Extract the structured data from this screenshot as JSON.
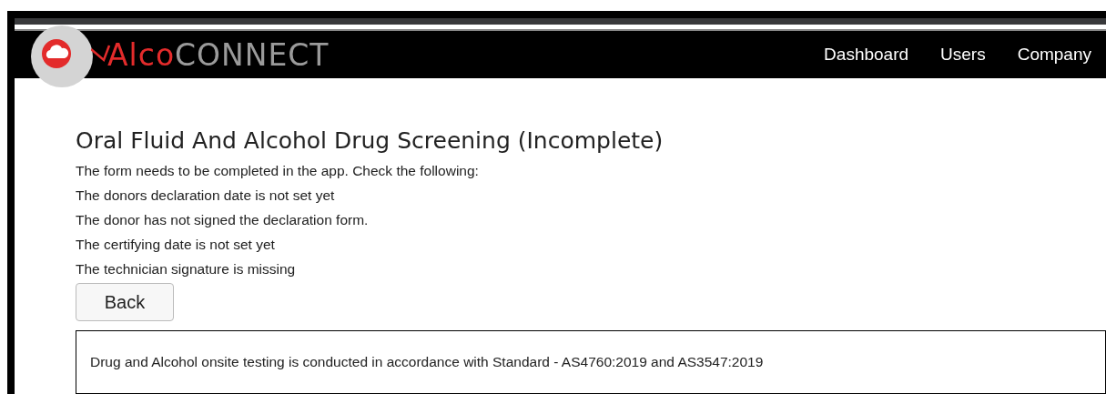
{
  "brand": {
    "part_1": "Alco",
    "part_2": "CONNECT"
  },
  "nav": [
    {
      "label": "Dashboard"
    },
    {
      "label": "Users"
    },
    {
      "label": "Company"
    }
  ],
  "title": "Oral Fluid And Alcohol Drug Screening (Incomplete)",
  "messages": [
    "The form needs to be completed in the app. Check the following:",
    "The donors declaration date is not set yet",
    "The donor has not signed the declaration form.",
    "The certifying date is not set yet",
    "The technician signature is missing"
  ],
  "back_button": "Back",
  "footer_note": "Drug and Alcohol onsite testing is conducted in accordance with Standard - AS4760:2019 and AS3547:2019"
}
